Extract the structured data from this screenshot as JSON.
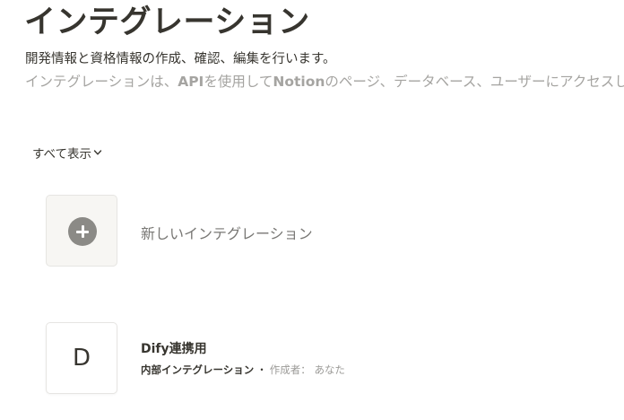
{
  "header": {
    "title": "インテグレーション",
    "description_primary": "開発情報と資格情報の作成、確認、編集を行います。",
    "description_secondary_before": "インテグレーションは、",
    "description_secondary_api": "API",
    "description_secondary_mid": "を使用して",
    "description_secondary_notion": "Notion",
    "description_secondary_after": "のページ、データベース、ユーザーにアクセスします。"
  },
  "filter": {
    "label": "すべて表示",
    "icon": "chevron-down-icon"
  },
  "new_integration": {
    "icon": "plus-icon",
    "label": "新しいインテグレーション"
  },
  "integrations": [
    {
      "avatar_letter": "D",
      "name": "Dify連携用",
      "type": "内部インテグレーション",
      "separator": "・",
      "author_label": "作成者：",
      "author": "あなた"
    }
  ],
  "colors": {
    "text_primary": "#37352f",
    "text_secondary": "#a5a4a1",
    "plus_circle": "#8b8a86",
    "card_bg": "#f7f6f3",
    "card_border": "#e6e5e2"
  }
}
